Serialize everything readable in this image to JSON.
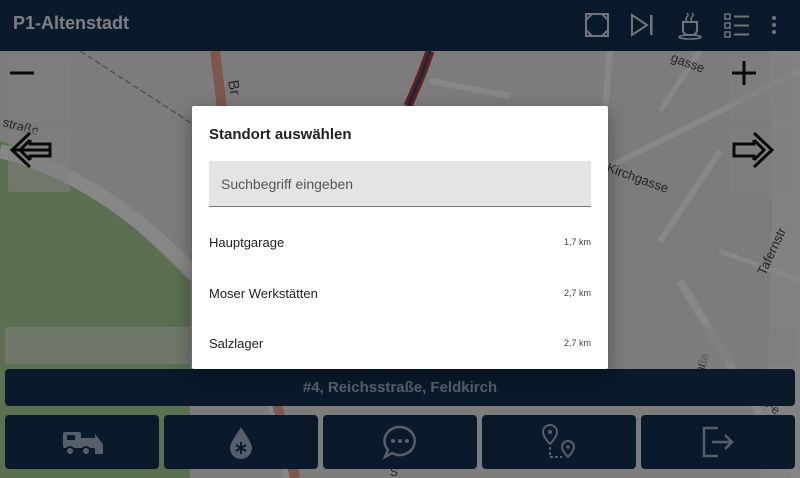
{
  "app": {
    "title": "P1-Altenstadt"
  },
  "toolbar": {
    "icons": [
      "fullscreen-icon",
      "play-pause-icon",
      "coffee-break-icon",
      "checklist-icon",
      "overflow-menu-icon"
    ]
  },
  "map": {
    "street_labels": [
      "Br",
      "gasse",
      "Kirchgasse",
      "straße",
      "Tafernstr",
      "traße",
      "Fe",
      "S"
    ]
  },
  "address_bar": {
    "text": "#4, Reichsstraße, Feldkirch"
  },
  "bottom_buttons": [
    "snowplow-truck-icon",
    "salt-drop-icon",
    "chat-bubble-icon",
    "route-pins-icon",
    "exit-icon"
  ],
  "dialog": {
    "title": "Standort auswählen",
    "search_placeholder": "Suchbegriff eingeben",
    "locations": [
      {
        "name": "Hauptgarage",
        "distance": "1,7 km"
      },
      {
        "name": "Moser Werkstätten",
        "distance": "2,7 km"
      },
      {
        "name": "Salzlager",
        "distance": "2,7 km"
      }
    ]
  },
  "colors": {
    "primary": "#14304f",
    "overlay": "#000000",
    "dialog_bg": "#ffffff"
  }
}
